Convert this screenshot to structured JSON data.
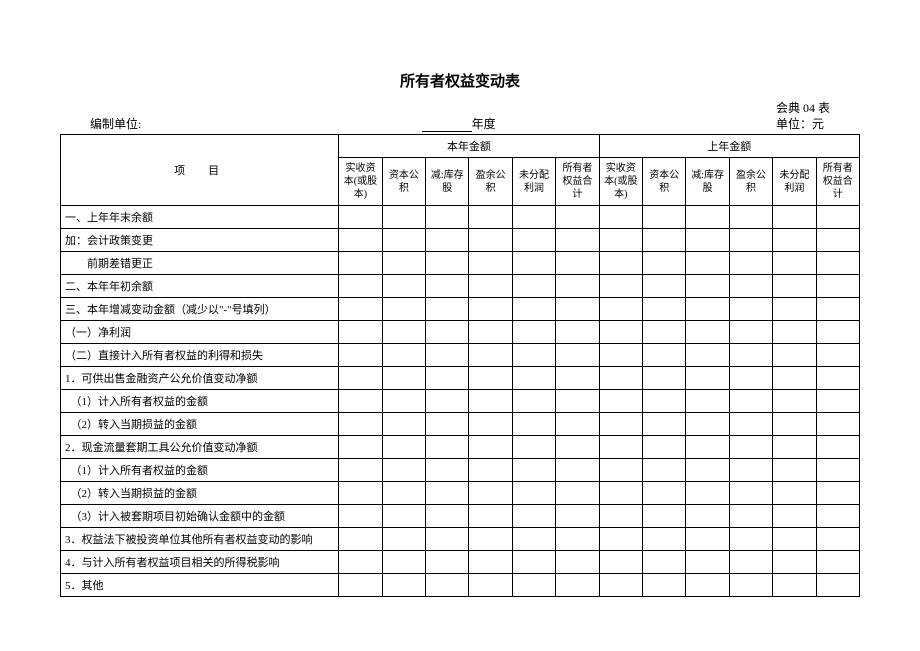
{
  "title": "所有者权益变动表",
  "form_code": "会典 04 表",
  "unit_prefix": "编制单位:",
  "period_suffix": "年度",
  "currency_label": "单位：元",
  "group_headers": {
    "item": "项　目",
    "current": "本年金额",
    "prior": "上年金额"
  },
  "sub_headers": [
    "实收资本(或股本)",
    "资本公积",
    "减:库存股",
    "盈余公积",
    "未分配利润",
    "所有者权益合计"
  ],
  "rows": [
    "一、上年年末余额",
    "加：会计政策变更",
    "　　前期差错更正",
    "二、本年年初余额",
    "三、本年增减变动金额（减少以\"-\"号填列）",
    "（一）净利润",
    "（二）直接计入所有者权益的利得和损失",
    "1．可供出售金融资产公允价值变动净额",
    "　（1）计入所有者权益的金额",
    "　（2）转入当期损益的金额",
    "2．现金流量套期工具公允价值变动净额",
    "　（1）计入所有者权益的金额",
    "　（2）转入当期损益的金额",
    "　（3）计入被套期项目初始确认金额中的金额",
    "3．权益法下被投资单位其他所有者权益变动的影响",
    "4．与计入所有者权益项目相关的所得税影响",
    "5．其他"
  ]
}
